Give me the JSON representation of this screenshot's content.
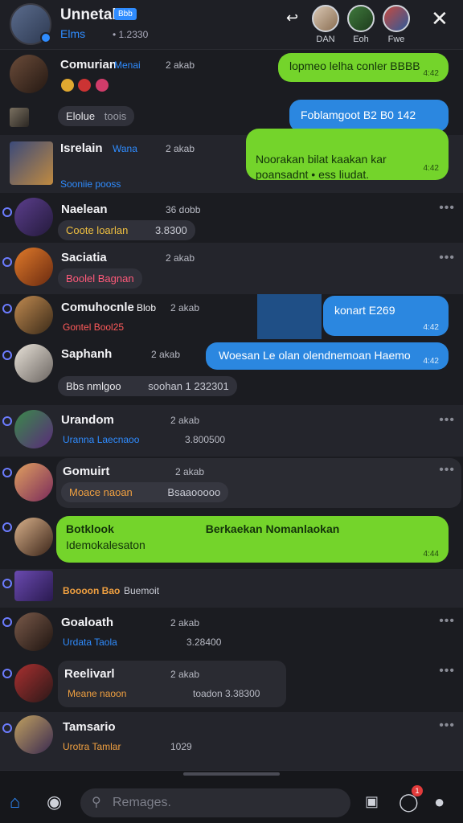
{
  "header": {
    "title": "Unnetak",
    "tag": "Bbb",
    "subtitle": "Elms",
    "subtitle_meta": "• 1.2330",
    "action_icon": "reply-icon",
    "participants": [
      {
        "label": "DAN"
      },
      {
        "label": "Eoh"
      },
      {
        "label": "Fwe"
      }
    ]
  },
  "conversations": [
    {
      "name": "Comurian",
      "tag": "Menai",
      "time": "2 akab",
      "preview": "",
      "bubble": "lopmeo lelha conler BBBB",
      "bubble_time": "4:42",
      "bubble_kind": "green"
    },
    {
      "name": "Elolue",
      "tag": "",
      "time": "toois",
      "preview": "",
      "bubble": "Foblamgoot B2 B0 142",
      "bubble_time": "",
      "bubble_kind": "blue"
    },
    {
      "name": "Isrelain",
      "tag": "Wana",
      "time": "2 akab",
      "preview": "Sooniie pooss",
      "bubble": "Noorakan bilat kaakan kar\npoansadnt  • ess liudat.",
      "bubble_time": "4:42",
      "bubble_kind": "green"
    },
    {
      "name": "Naelean",
      "tag": "",
      "time": "36 dobb",
      "preview": "Coote loarlan",
      "meta": "3.8300",
      "bubble": "",
      "bubble_time": "",
      "bubble_kind": ""
    },
    {
      "name": "Saciatia",
      "tag": "",
      "time": "2 akab",
      "preview": "Boolel  Bagnan",
      "meta": "",
      "bubble": "",
      "bubble_time": "",
      "bubble_kind": ""
    },
    {
      "name": "Comuhocnle",
      "tag": "Blob",
      "time": "2 akab",
      "preview": "Gontel  Bool25",
      "meta": "",
      "bubble": "konart  E269",
      "bubble_time": "4:42",
      "bubble_kind": "blue"
    },
    {
      "name": "Saphanh",
      "tag": "",
      "time": "2 akab",
      "preview": "Bbs nmlgoo",
      "meta": "soohan 1 232301",
      "bubble": "Woesan  Le olan olendnemoan  Haemo",
      "bubble_time": "4:42",
      "bubble_kind": "blue"
    },
    {
      "name": "Urandom",
      "tag": "",
      "time": "2 akab",
      "preview": "Uranna  Laecnaoo",
      "meta": "3.800500",
      "bubble": "",
      "bubble_time": "",
      "bubble_kind": ""
    },
    {
      "name": "Gomuirt",
      "tag": "",
      "time": "2 akab",
      "preview": "Moace naoan",
      "meta": "Bsaaooooo",
      "bubble": "",
      "bubble_time": "",
      "bubble_kind": ""
    },
    {
      "name": "Botklook",
      "tag": "",
      "time": "",
      "preview": "Idemokalesaton",
      "meta": "",
      "bubble": "Berkaekan Nomanlaokan",
      "bubble_time": "4:44",
      "bubble_kind": "greenrow"
    },
    {
      "name": "Boooon Bao",
      "tag": "",
      "time": "",
      "preview": "Buemoit",
      "meta": "",
      "bubble": "",
      "bubble_time": "",
      "bubble_kind": ""
    },
    {
      "name": "Goaloath",
      "tag": "",
      "time": "2 akab",
      "preview": "Urdata  Taola",
      "meta": "3.28400",
      "bubble": "",
      "bubble_time": "",
      "bubble_kind": ""
    },
    {
      "name": "Reelivarl",
      "tag": "",
      "time": "2 akab",
      "preview": "Meane naoon",
      "meta": "toadon  3.38300",
      "bubble": "",
      "bubble_time": "",
      "bubble_kind": ""
    },
    {
      "name": "Tamsario",
      "tag": "",
      "time": "",
      "preview": "Urotra  Tamlar",
      "meta": "1029",
      "bubble": "",
      "bubble_time": "",
      "bubble_kind": ""
    }
  ],
  "bottom": {
    "search_placeholder": "Remages.",
    "notification_count": "1"
  },
  "colors": {
    "background": "#1b1c21",
    "green_bubble": "#74d42b",
    "blue_bubble": "#2b87e0",
    "accent": "#2f8cff"
  }
}
